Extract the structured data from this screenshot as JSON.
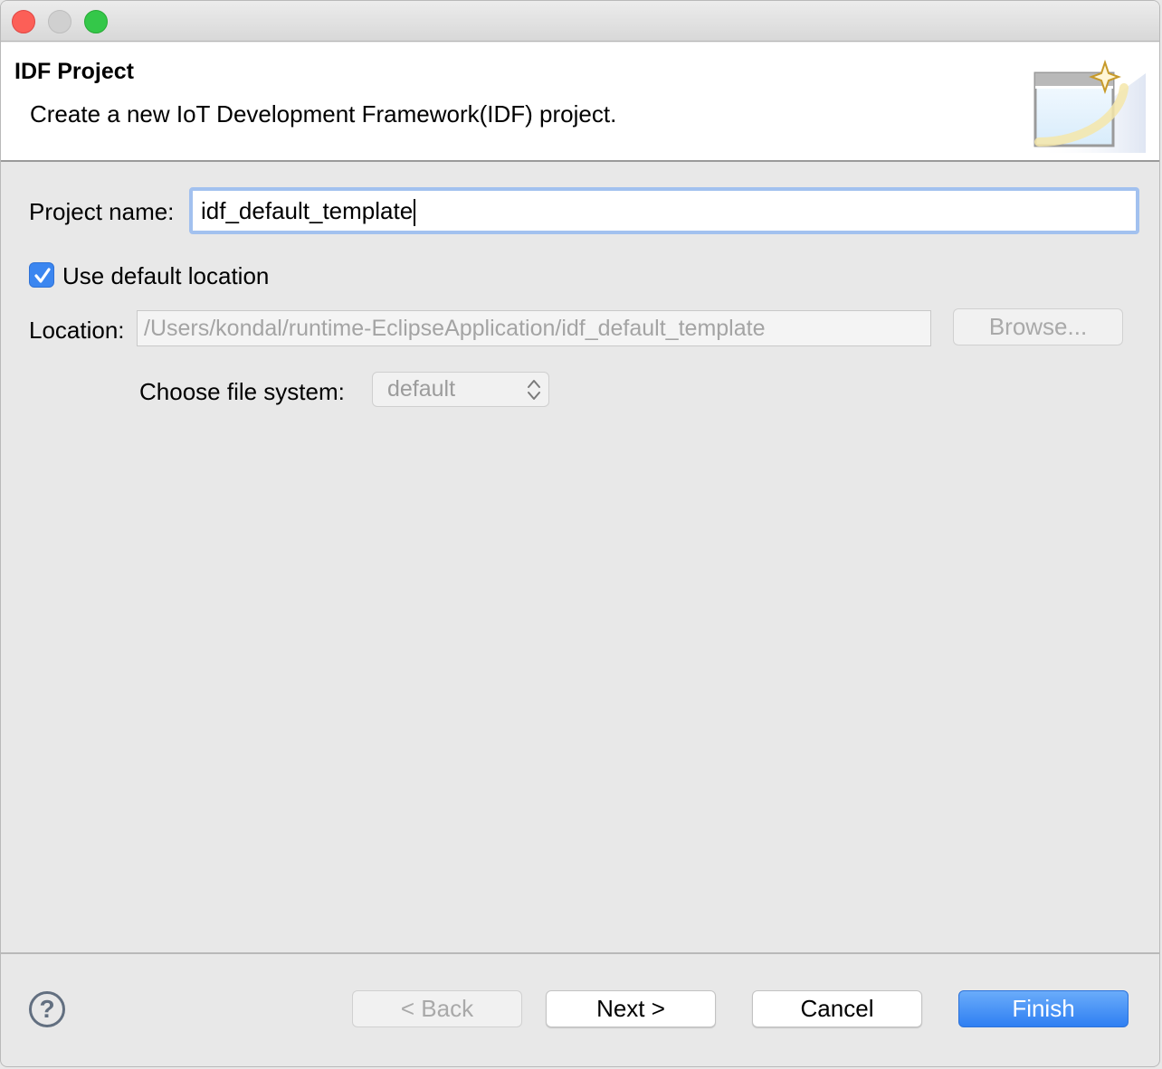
{
  "window": {
    "controls": [
      "close",
      "minimize",
      "zoom"
    ]
  },
  "banner": {
    "title": "IDF Project",
    "description": "Create a new IoT Development Framework(IDF) project.",
    "icon": "new-project-wizard-icon"
  },
  "form": {
    "project_name_label": "Project name:",
    "project_name_value": "idf_default_template",
    "use_default_location_label": "Use default location",
    "use_default_location_checked": true,
    "location_label": "Location:",
    "location_value": "/Users/kondal/runtime-EclipseApplication/idf_default_template",
    "browse_label": "Browse...",
    "file_system_label": "Choose file system:",
    "file_system_value": "default"
  },
  "footer": {
    "help_icon": "question-mark-icon",
    "back_label": "< Back",
    "next_label": "Next >",
    "cancel_label": "Cancel",
    "finish_label": "Finish"
  },
  "colors": {
    "accent": "#3b86f0",
    "focus_ring": "#a2c1ef",
    "close": "#fc5f57",
    "zoom": "#34c749"
  }
}
